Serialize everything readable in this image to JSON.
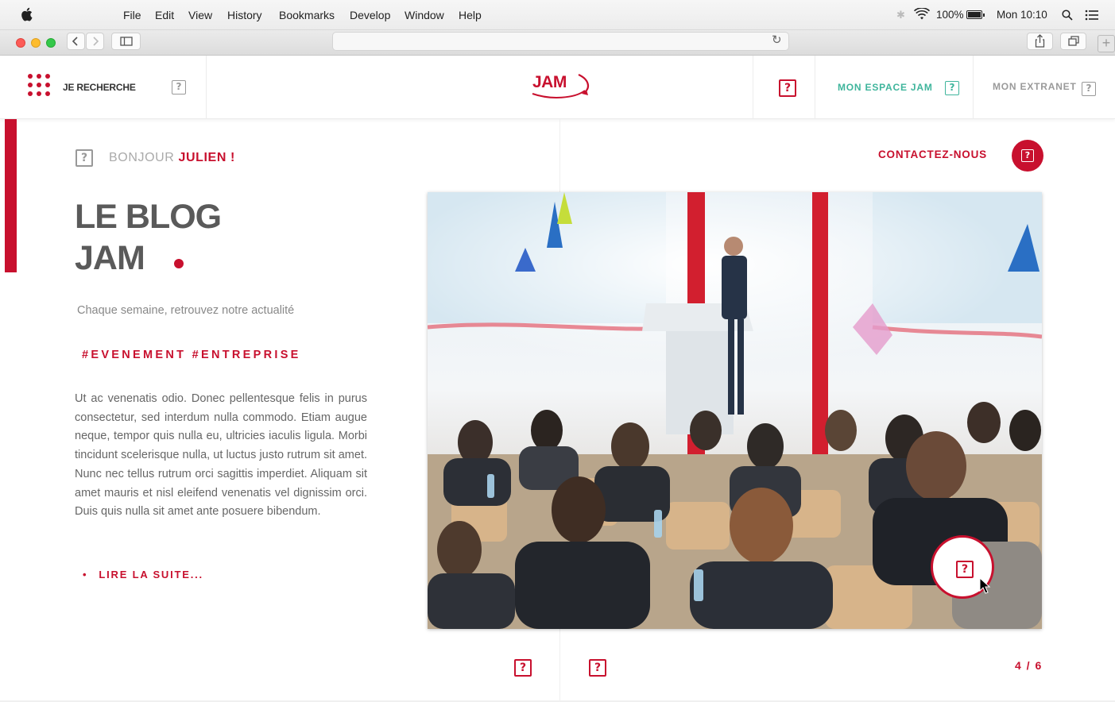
{
  "menubar": {
    "items": [
      "File",
      "Edit",
      "View",
      "History",
      "Bookmarks",
      "Develop",
      "Window",
      "Help"
    ],
    "battery": "100%",
    "clock": "Mon 10:10"
  },
  "header": {
    "search_label": "JE RECHERCHE",
    "logo_text": "JAM",
    "space_label": "MON ESPACE JAM",
    "extranet_label": "MON EXTRANET",
    "help_glyph": "?"
  },
  "content": {
    "greeting_prefix": "BONJOUR",
    "greeting_name": "JULIEN !",
    "title_line1": "LE BLOG",
    "title_line2": "JAM",
    "subtitle": "Chaque semaine, retrouvez notre actualité",
    "tags": "#EVENEMENT #ENTREPRISE",
    "body": "Ut ac venenatis odio. Donec pellentesque felis in purus consectetur, sed interdum nulla commodo. Etiam augue neque, tempor quis nulla eu, ultricies iaculis ligula. Morbi tincidunt scelerisque nulla, ut luctus justo rutrum sit amet. Nunc nec tellus rutrum orci sagittis imperdiet. Aliquam sit amet mauris et nisl eleifend venenatis vel dignissim orci. Duis quis nulla sit amet ante posuere bibendum.",
    "read_more_bullet": "•",
    "read_more": "LIRE LA SUITE..."
  },
  "contact": {
    "label": "CONTACTEZ-NOUS"
  },
  "pager": {
    "text": "4 / 6"
  },
  "colors": {
    "brand_red": "#c8102e",
    "teal": "#3fb59c"
  }
}
